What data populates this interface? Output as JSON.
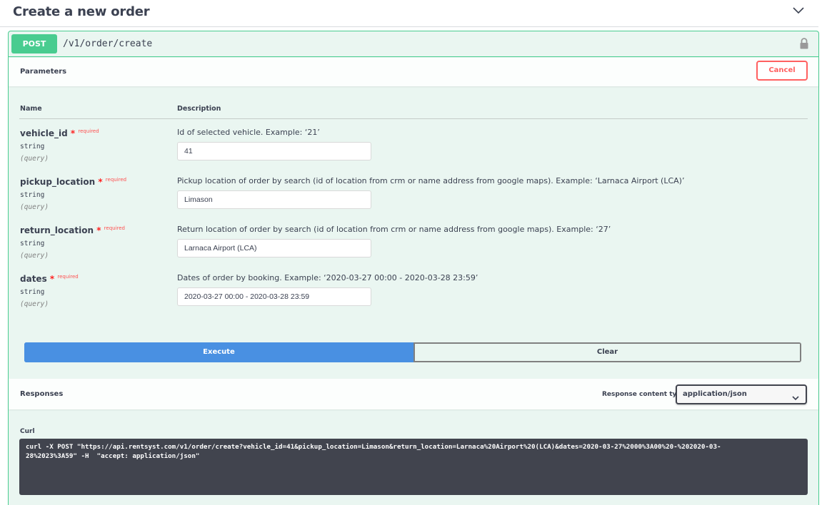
{
  "section": {
    "title": "Create a new order",
    "collapse_icon": "chevron-down-icon"
  },
  "operation": {
    "method": "POST",
    "path": "/v1/order/create",
    "lock_icon": "lock-icon",
    "color": "#49cc90"
  },
  "parameters": {
    "label": "Parameters",
    "cancel_label": "Cancel",
    "col_name": "Name",
    "col_description": "Description",
    "required_marker": "*",
    "required_text": "required",
    "items": [
      {
        "name": "vehicle_id",
        "type": "string",
        "in": "(query)",
        "description": "Id of selected vehicle. Example: ‘21’",
        "value": "41"
      },
      {
        "name": "pickup_location",
        "type": "string",
        "in": "(query)",
        "description": "Pickup location of order by search (id of location from crm or name address from google maps). Example: ‘Larnaca Airport (LCA)’",
        "value": "Limason"
      },
      {
        "name": "return_location",
        "type": "string",
        "in": "(query)",
        "description": "Return location of order by search (id of location from crm or name address from google maps). Example: ‘27’",
        "value": "Larnaca Airport (LCA)"
      },
      {
        "name": "dates",
        "type": "string",
        "in": "(query)",
        "description": "Dates of order by booking. Example: ‘2020-03-27 00:00 - 2020-03-28 23:59’",
        "value": "2020-03-27 00:00 - 2020-03-28 23:59"
      }
    ]
  },
  "actions": {
    "execute_label": "Execute",
    "clear_label": "Clear",
    "execute_color": "#4990e2"
  },
  "responses": {
    "label": "Responses",
    "content_type_label": "Response content type",
    "content_type_value": "application/json"
  },
  "curl": {
    "label": "Curl",
    "line1": "curl -X POST \"https://api.rentsyst.com/v1/order/create?vehicle_id=41&pickup_location=Limason&return_location=Larnaca%20Airport%20(LCA)&dates=2020-03-27%2000%3A00%20-%202020-03-",
    "line2": "28%2023%3A59\" -H  \"accept: application/json\""
  }
}
